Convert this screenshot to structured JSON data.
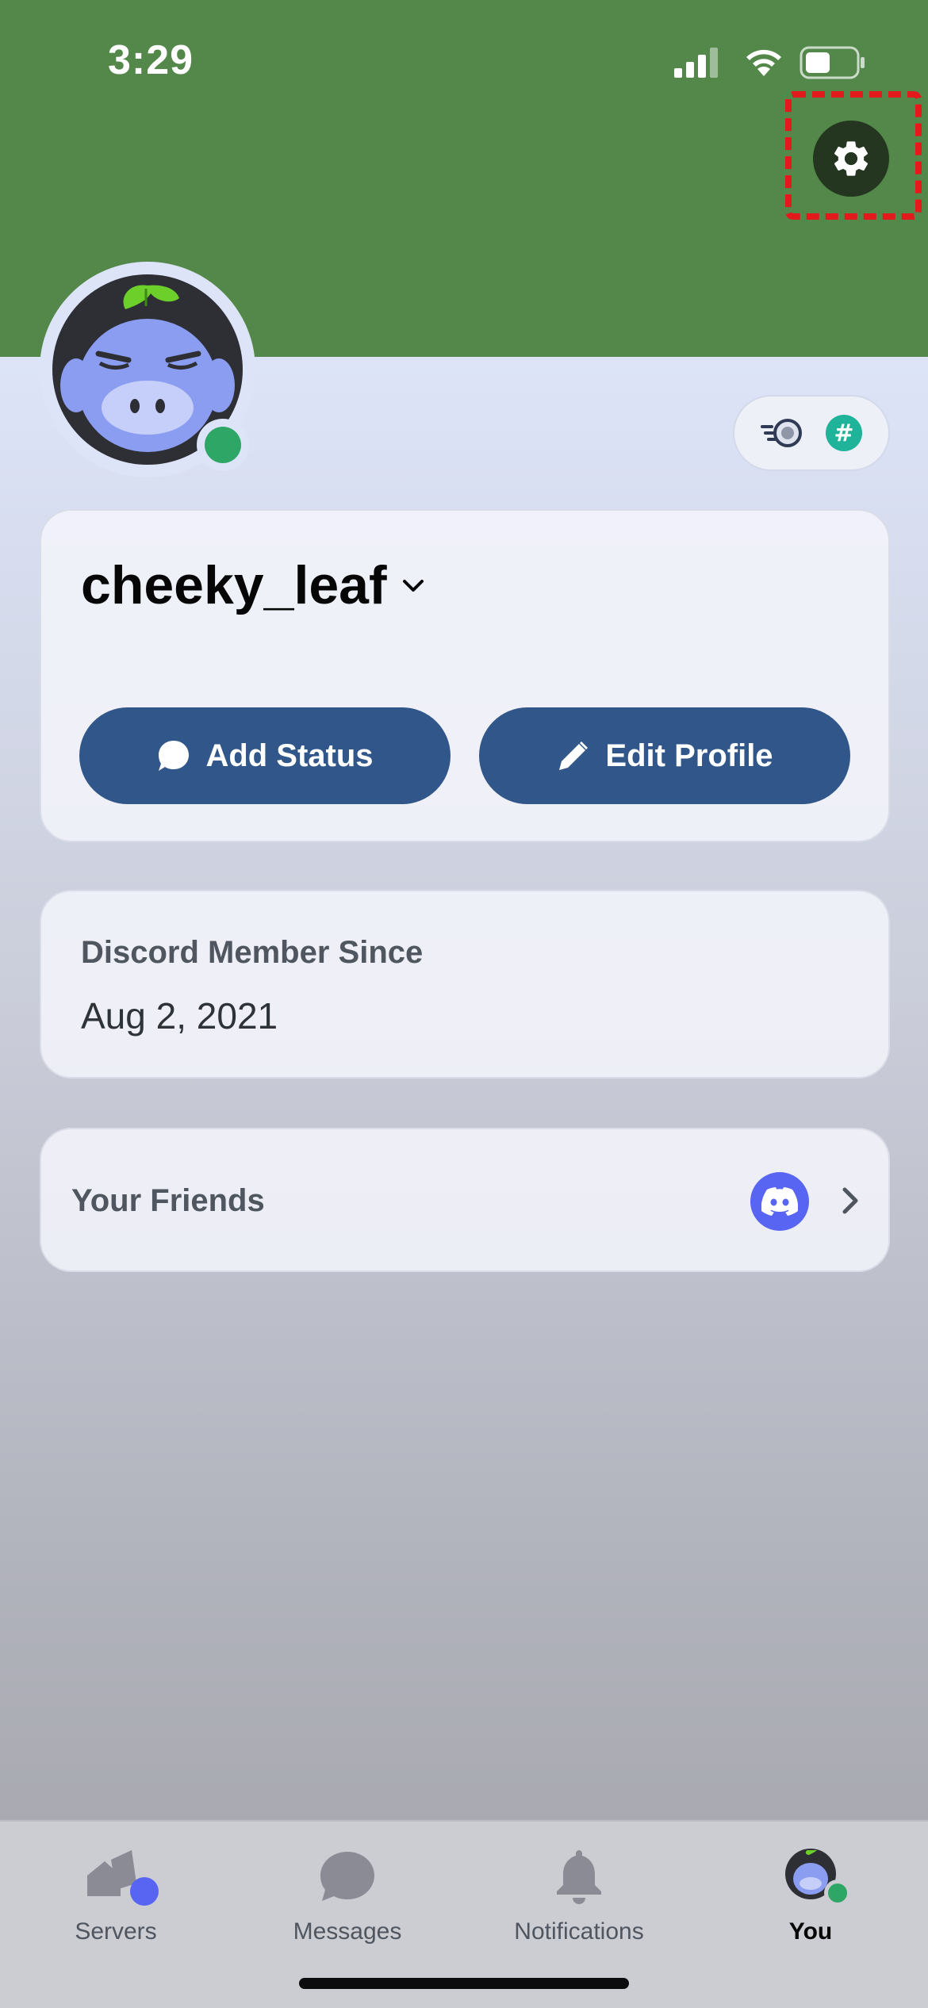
{
  "status_bar": {
    "time": "3:29"
  },
  "profile": {
    "username": "cheeky_leaf",
    "online": true,
    "add_status_label": "Add Status",
    "edit_profile_label": "Edit Profile"
  },
  "member_since": {
    "label": "Discord Member Since",
    "date": "Aug 2, 2021"
  },
  "friends": {
    "label": "Your Friends"
  },
  "tabs": [
    {
      "label": "Servers",
      "icon": "servers-icon"
    },
    {
      "label": "Messages",
      "icon": "chat-bubble-icon"
    },
    {
      "label": "Notifications",
      "icon": "bell-icon"
    },
    {
      "label": "You",
      "icon": "avatar-icon",
      "active": true
    }
  ],
  "colors": {
    "banner": "#53884a",
    "button": "#31568a",
    "online": "#2ea665",
    "blurple": "#5865f2",
    "highlight": "#e3191c"
  }
}
